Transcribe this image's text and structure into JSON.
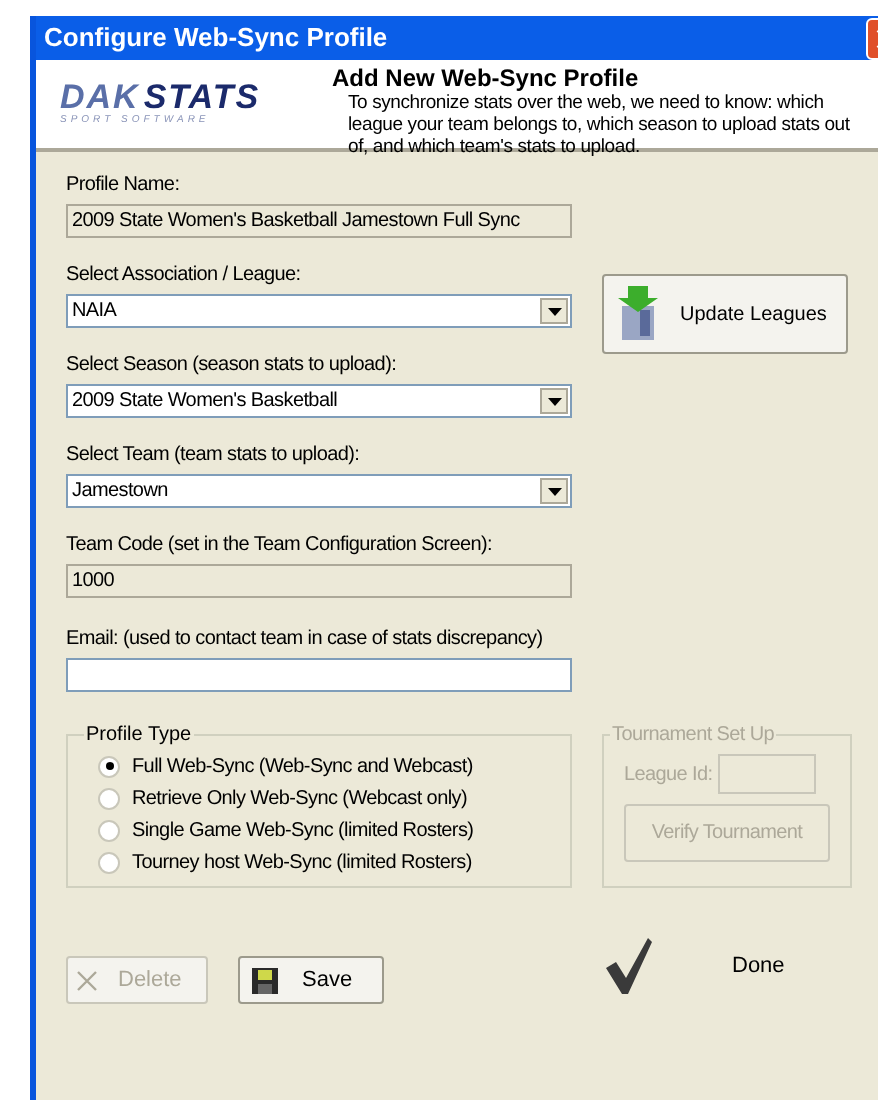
{
  "window": {
    "title": "Configure Web-Sync Profile"
  },
  "header": {
    "logo_main": "DAK",
    "logo_accent": "STATS",
    "logo_sub": "SPORT SOFTWARE",
    "title": "Add New Web-Sync Profile",
    "description": "To synchronize stats over the web, we need to know: which league your team belongs to, which season to upload stats out of, and which team's stats to upload."
  },
  "fields": [
    {
      "kind": "readonly",
      "label": "Profile Name:",
      "value": "2009 State Women's Basketball Jamestown Full Sync"
    },
    {
      "kind": "dropdown",
      "label": "Select Association / League:",
      "value": "NAIA"
    },
    {
      "kind": "dropdown",
      "label": "Select Season (season stats to upload):",
      "value": "2009 State Women's Basketball"
    },
    {
      "kind": "dropdown",
      "label": "Select Team (team stats to upload):",
      "value": "Jamestown"
    },
    {
      "kind": "readonly",
      "label": "Team Code  (set in the Team Configuration Screen):",
      "value": "1000"
    },
    {
      "kind": "text",
      "label": "Email: (used to contact team in case of stats discrepancy)"
    }
  ],
  "update_button": {
    "label": "Update Leagues"
  },
  "profile_type": {
    "title": "Profile Type",
    "options": [
      {
        "label": "Full Web-Sync (Web-Sync and Webcast)",
        "selected": true
      },
      {
        "label": "Retrieve Only Web-Sync (Webcast only)",
        "selected": false
      },
      {
        "label": "Single Game Web-Sync (limited Rosters)",
        "selected": false
      },
      {
        "label": "Tourney host Web-Sync (limited Rosters)",
        "selected": false
      }
    ]
  },
  "tournament": {
    "title": "Tournament Set Up",
    "disabled": true,
    "league_id_label": "League Id:",
    "verify_button": "Verify Tournament"
  },
  "buttons": [
    {
      "kind": "delete",
      "label": "Delete",
      "disabled": true
    },
    {
      "kind": "save",
      "label": "Save",
      "disabled": false
    },
    {
      "kind": "done",
      "label": "Done",
      "disabled": false
    }
  ]
}
